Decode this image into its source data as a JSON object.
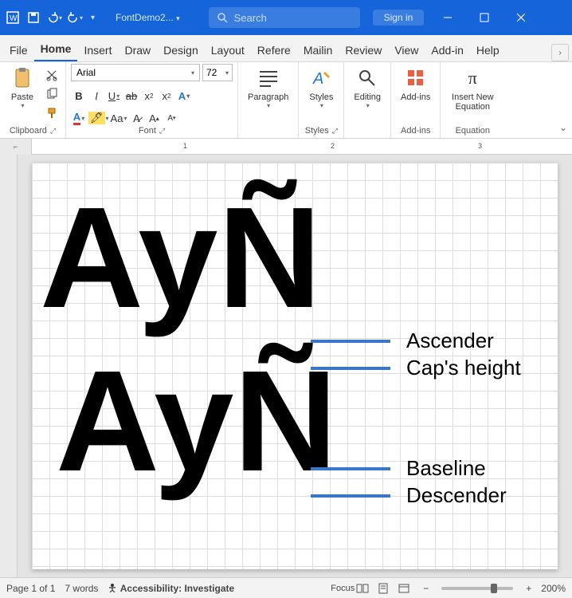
{
  "titlebar": {
    "filename": "FontDemo2...",
    "search_placeholder": "Search",
    "signin": "Sign in"
  },
  "tabs": {
    "items": [
      "File",
      "Home",
      "Insert",
      "Draw",
      "Design",
      "Layout",
      "Refere",
      "Mailin",
      "Review",
      "View",
      "Add-in",
      "Help"
    ],
    "active_index": 1
  },
  "ribbon": {
    "clipboard": {
      "paste": "Paste",
      "label": "Clipboard"
    },
    "font": {
      "name": "Arial",
      "size": "72",
      "label": "Font"
    },
    "paragraph": {
      "btn": "Paragraph"
    },
    "styles": {
      "btn": "Styles",
      "label": "Styles"
    },
    "editing": {
      "btn": "Editing"
    },
    "addins": {
      "btn": "Add-ins",
      "label": "Add-ins"
    },
    "equation": {
      "btn": "Insert New Equation",
      "label": "Equation"
    }
  },
  "ruler": {
    "marks": [
      "1",
      "2",
      "3"
    ]
  },
  "document": {
    "sample1": "AyÑ",
    "sample2": "AyÑ",
    "annotations": {
      "ascender": "Ascender",
      "capheight": "Cap's height",
      "baseline": "Baseline",
      "descender": "Descender"
    }
  },
  "statusbar": {
    "page": "Page 1 of 1",
    "words": "7 words",
    "accessibility": "Accessibility: Investigate",
    "focus": "Focus",
    "zoom": "200%"
  }
}
